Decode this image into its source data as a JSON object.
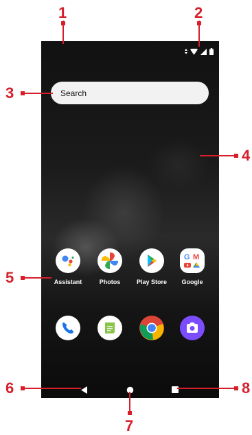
{
  "search": {
    "label": "Search"
  },
  "apps": [
    {
      "name": "Assistant",
      "icon": "assistant-icon"
    },
    {
      "name": "Photos",
      "icon": "photos-icon"
    },
    {
      "name": "Play Store",
      "icon": "play-store-icon"
    },
    {
      "name": "Google",
      "icon": "google-folder-icon"
    }
  ],
  "dock": [
    {
      "icon": "phone-icon"
    },
    {
      "icon": "messages-icon"
    },
    {
      "icon": "chrome-icon"
    },
    {
      "icon": "camera-icon"
    }
  ],
  "nav": {
    "back": "back-icon",
    "home": "home-icon",
    "recents": "recents-icon"
  },
  "callouts": [
    "1",
    "2",
    "3",
    "4",
    "5",
    "6",
    "7",
    "8"
  ],
  "colors": {
    "callout": "#d61f2b"
  }
}
